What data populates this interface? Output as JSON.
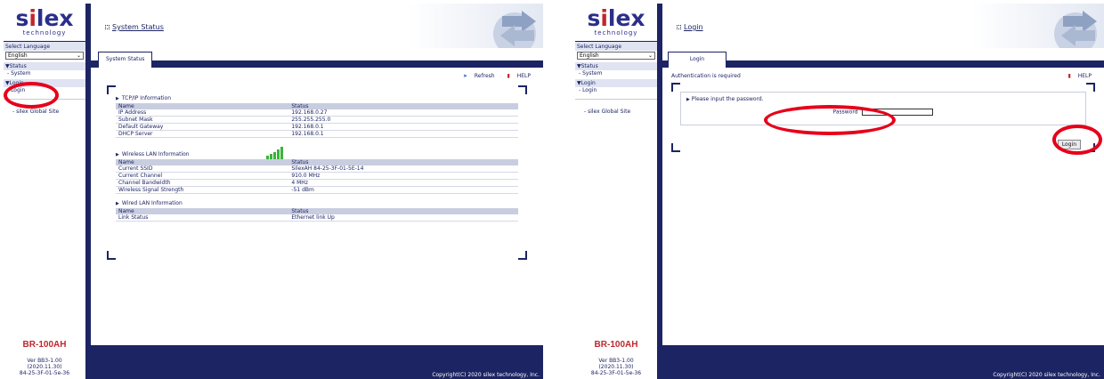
{
  "brand": {
    "logo_text": "silex",
    "logo_sub": "technology"
  },
  "colors": {
    "navy": "#1c2463",
    "header_gray": "#c9cde0",
    "brand_red": "#c0272d",
    "highlight_red": "#e6001a"
  },
  "left_screen": {
    "sidebar": {
      "language_label": "Select Language",
      "language_value": "English",
      "status_head": "▼Status",
      "status_item": "- System",
      "login_head": "▼Login",
      "login_item": "- Login",
      "global_site": "-  silex Global Site",
      "model": "BR-100AH",
      "fw_line1": "Ver BB3-1.00",
      "fw_line2": "(2020.11.30)",
      "fw_line3": "84-25-3F-01-5e-36"
    },
    "title": "System Status",
    "tab": "System Status",
    "toolbar": {
      "refresh": "Refresh",
      "help": "HELP"
    },
    "tcpip": {
      "heading": "TCP/IP Information",
      "header": [
        "Name",
        "Status"
      ],
      "rows": [
        [
          "IP Address",
          "192.168.0.27"
        ],
        [
          "Subnet Mask",
          "255.255.255.0"
        ],
        [
          "Default Gateway",
          "192.168.0.1"
        ],
        [
          "DHCP Server",
          "192.168.0.1"
        ]
      ]
    },
    "wireless": {
      "heading": "Wireless LAN Information",
      "signal_bars": 5,
      "header": [
        "Name",
        "Status"
      ],
      "rows": [
        [
          "Current SSID",
          "SilexAH    84-25-3F-01-5E-14"
        ],
        [
          "Current Channel",
          "910.0 MHz"
        ],
        [
          "Channel Bandwidth",
          "4 MHz"
        ],
        [
          "Wireless Signal Strength",
          "-51 dBm"
        ]
      ]
    },
    "wired": {
      "heading": "Wired LAN Information",
      "header": [
        "Name",
        "Status"
      ],
      "rows": [
        [
          "Link Status",
          "Ethernet link Up"
        ]
      ]
    },
    "copyright": "Copyright(C) 2020 silex technology, Inc."
  },
  "right_screen": {
    "sidebar": {
      "language_label": "Select Language",
      "language_value": "English",
      "status_head": "▼Status",
      "status_item": "- System",
      "login_head": "▼Login",
      "login_item": "- Login",
      "global_site": "-  silex Global Site",
      "model": "BR-100AH",
      "fw_line1": "Ver BB3-1.00",
      "fw_line2": "(2020.11.30)",
      "fw_line3": "84-25-3F-01-5e-36"
    },
    "title": "Login",
    "tab": "Login",
    "help": "HELP",
    "auth_text": "Authentication is required",
    "prompt": "Please input the password.",
    "password_label": "Password",
    "password_value": "",
    "login_button": "Login",
    "copyright": "Copyright(C) 2020 silex technology, Inc."
  }
}
